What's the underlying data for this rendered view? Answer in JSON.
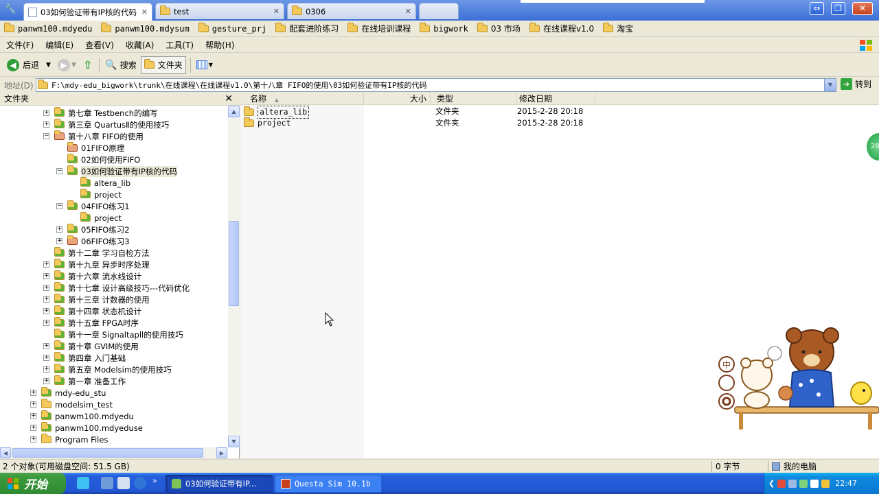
{
  "browser": {
    "tabs": [
      {
        "label": "03如何验证带有IP核的代码",
        "active": true
      },
      {
        "label": "test",
        "active": false
      },
      {
        "label": "0306",
        "active": false
      }
    ]
  },
  "favorites": [
    "panwm100.mdyedu",
    "panwm100.mdysum",
    "gesture_prj",
    "配套进阶练习",
    "在线培训课程",
    "bigwork",
    "03 市场",
    "在线课程v1.0",
    "淘宝"
  ],
  "menu": [
    "文件(F)",
    "编辑(E)",
    "查看(V)",
    "收藏(A)",
    "工具(T)",
    "帮助(H)"
  ],
  "toolbar": {
    "back": "后退",
    "search": "搜索",
    "folders": "文件夹"
  },
  "address": {
    "label": "地址(D)",
    "path": "F:\\mdy-edu_bigwork\\trunk\\在线课程\\在线课程v1.0\\第十八章 FIFO的使用\\03如何验证带有IP核的代码",
    "go": "转到"
  },
  "folders_pane": {
    "title": "文件夹",
    "tree": [
      {
        "label": "第七章 Testbench的编写",
        "exp": "+"
      },
      {
        "label": "第三章 QuartusⅡ的使用技巧",
        "exp": "+"
      },
      {
        "label": "第十八章 FIFO的使用",
        "exp": "-"
      },
      {
        "label": "01FIFO原理",
        "exp": ""
      },
      {
        "label": "02如何使用FIFO",
        "exp": ""
      },
      {
        "label": "03如何验证带有IP核的代码",
        "exp": "-"
      },
      {
        "label": "altera_lib",
        "exp": ""
      },
      {
        "label": "project",
        "exp": ""
      },
      {
        "label": "04FIFO练习1",
        "exp": "-"
      },
      {
        "label": "project",
        "exp": ""
      },
      {
        "label": "05FIFO练习2",
        "exp": "+"
      },
      {
        "label": "06FIFO练习3",
        "exp": "+"
      },
      {
        "label": "第十二章 学习自检方法",
        "exp": ""
      },
      {
        "label": "第十九章 异步时序处理",
        "exp": "+"
      },
      {
        "label": "第十六章 流水线设计",
        "exp": "+"
      },
      {
        "label": "第十七章 设计高级技巧---代码优化",
        "exp": "+"
      },
      {
        "label": "第十三章 计数器的使用",
        "exp": "+"
      },
      {
        "label": "第十四章 状态机设计",
        "exp": "+"
      },
      {
        "label": "第十五章 FPGA时序",
        "exp": "+"
      },
      {
        "label": "第十一章 Signaltapll的使用技巧",
        "exp": ""
      },
      {
        "label": "第十章 GVIM的使用",
        "exp": "+"
      },
      {
        "label": "第四章 入门基础",
        "exp": "+"
      },
      {
        "label": "第五章 Modelsim的使用技巧",
        "exp": "+"
      },
      {
        "label": "第一章 准备工作",
        "exp": "+"
      },
      {
        "label": "mdy-edu_stu",
        "exp": "+"
      },
      {
        "label": "modelsim_test",
        "exp": "+"
      },
      {
        "label": "panwm100.mdyedu",
        "exp": "+"
      },
      {
        "label": "panwm100.mdyeduse",
        "exp": "+"
      },
      {
        "label": "Program Files",
        "exp": "+"
      }
    ]
  },
  "file_list": {
    "columns": [
      "名称",
      "大小",
      "类型",
      "修改日期"
    ],
    "rows": [
      {
        "name": "altera_lib",
        "size": "",
        "type": "文件夹",
        "modified": "2015-2-28 20:18"
      },
      {
        "name": "project",
        "size": "",
        "type": "文件夹",
        "modified": "2015-2-28 20:18"
      }
    ]
  },
  "side_badge": "28",
  "status": {
    "objects": "2 个对象(可用磁盘空间: 51.5 GB)",
    "size": "0 字节",
    "location": "我的电脑"
  },
  "taskbar": {
    "start": "开始",
    "buttons": [
      "03如何验证带有IP...",
      "Questa Sim 10.1b"
    ],
    "clock": "22:47"
  },
  "colors": {
    "taskbar": "#245edb",
    "start": "#3c9a3e",
    "selection": "#316ac5"
  }
}
